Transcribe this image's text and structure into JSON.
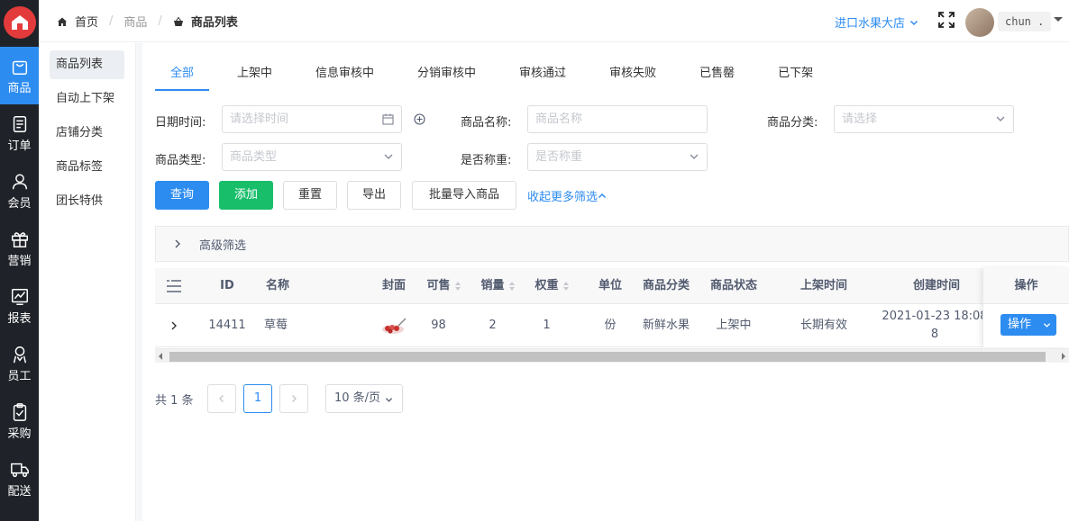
{
  "rail": {
    "items": [
      {
        "label": "商品",
        "icon": "bag-icon",
        "active": true
      },
      {
        "label": "订单",
        "icon": "order-icon"
      },
      {
        "label": "会员",
        "icon": "user-icon"
      },
      {
        "label": "营销",
        "icon": "gift-icon"
      },
      {
        "label": "报表",
        "icon": "chart-icon"
      },
      {
        "label": "员工",
        "icon": "staff-icon"
      },
      {
        "label": "采购",
        "icon": "clipboard-icon"
      },
      {
        "label": "配送",
        "icon": "truck-icon"
      }
    ]
  },
  "submenu": {
    "items": [
      "商品列表",
      "自动上下架",
      "店铺分类",
      "商品标签",
      "团长特供"
    ],
    "active_index": 0
  },
  "header": {
    "breadcrumb": [
      "首页",
      "商品",
      "商品列表"
    ],
    "store_name": "进口水果大店",
    "username": "chun ."
  },
  "tabs": [
    "全部",
    "上架中",
    "信息审核中",
    "分销审核中",
    "审核通过",
    "审核失败",
    "已售罄",
    "已下架"
  ],
  "filters": {
    "date_label": "日期时间:",
    "date_placeholder": "请选择时间",
    "name_label": "商品名称:",
    "name_placeholder": "商品名称",
    "category_label": "商品分类:",
    "category_placeholder": "请选择",
    "type_label": "商品类型:",
    "type_placeholder": "商品类型",
    "weigh_label": "是否称重:",
    "weigh_placeholder": "是否称重"
  },
  "actions": {
    "query": "查询",
    "add": "添加",
    "reset": "重置",
    "export": "导出",
    "batch_import": "批量导入商品",
    "collapse": "收起更多筛选"
  },
  "advanced_filter": "高级筛选",
  "table": {
    "columns": [
      "ID",
      "名称",
      "封面",
      "可售",
      "销量",
      "权重",
      "单位",
      "商品分类",
      "商品状态",
      "上架时间",
      "创建时间",
      "操作"
    ],
    "rows": [
      {
        "id": "14411",
        "name": "草莓",
        "stock": "98",
        "sales": "2",
        "weight": "1",
        "unit": "份",
        "category": "新鲜水果",
        "status": "上架中",
        "shelf_time": "长期有效",
        "created_line1": "2021-01-23 18:08",
        "created_line2": "8",
        "op": "操作"
      }
    ]
  },
  "pagination": {
    "total": "共 1 条",
    "current": "1",
    "page_size": "10 条/页"
  },
  "colors": {
    "primary": "#2d8cf0",
    "success": "#19be6b",
    "rail": "#1f2329"
  }
}
